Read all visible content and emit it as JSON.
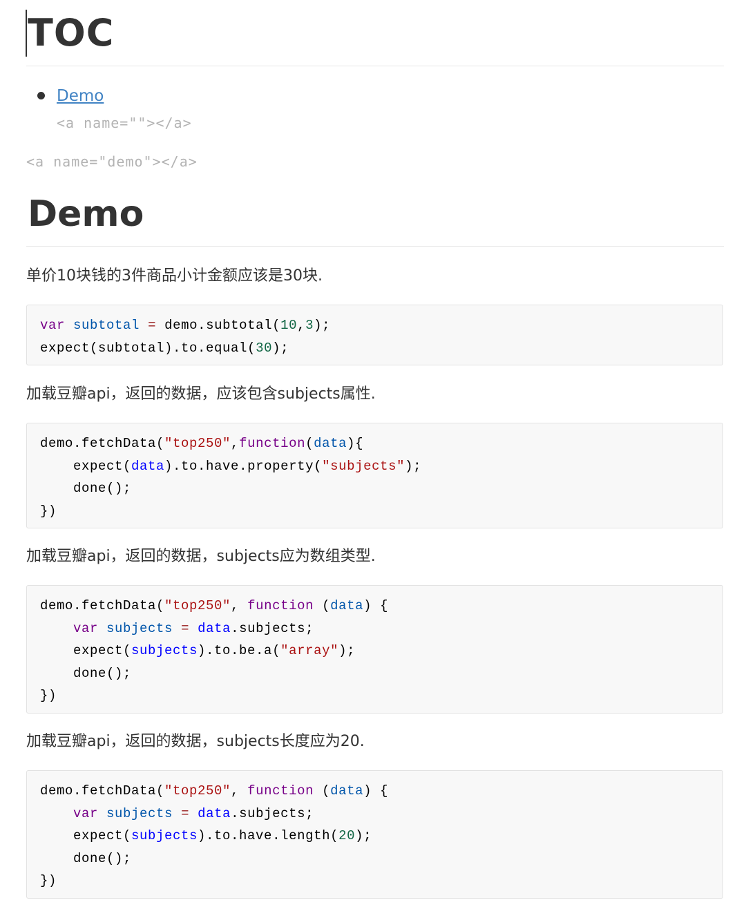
{
  "toc": {
    "title": "TOC",
    "items": [
      {
        "label": "Demo"
      }
    ],
    "anchor_under_item": "<a name=\"\"></a>"
  },
  "anchor_before_demo": "<a name=\"demo\"></a>",
  "demo": {
    "title": "Demo",
    "sections": [
      {
        "text": "单价10块钱的3件商品小计金额应该是30块.",
        "code": [
          [
            [
              "kw",
              "var"
            ],
            [
              "pl",
              " "
            ],
            [
              "def",
              "subtotal"
            ],
            [
              "pl",
              " "
            ],
            [
              "op",
              "="
            ],
            [
              "pl",
              " demo.subtotal("
            ],
            [
              "num",
              "10"
            ],
            [
              "pl",
              ","
            ],
            [
              "num",
              "3"
            ],
            [
              "pl",
              ");"
            ]
          ],
          [
            [
              "pl",
              "expect(subtotal).to.equal("
            ],
            [
              "num",
              "30"
            ],
            [
              "pl",
              ");"
            ]
          ]
        ]
      },
      {
        "text": "加载豆瓣api，返回的数据，应该包含subjects属性.",
        "code": [
          [
            [
              "pl",
              "demo.fetchData("
            ],
            [
              "str",
              "\"top250\""
            ],
            [
              "pl",
              ","
            ],
            [
              "kw",
              "function"
            ],
            [
              "pl",
              "("
            ],
            [
              "def",
              "data"
            ],
            [
              "pl",
              "){"
            ]
          ],
          [
            [
              "pl",
              "    expect("
            ],
            [
              "var",
              "data"
            ],
            [
              "pl",
              ").to.have.property("
            ],
            [
              "str",
              "\"subjects\""
            ],
            [
              "pl",
              ");"
            ]
          ],
          [
            [
              "pl",
              "    done();"
            ]
          ],
          [
            [
              "pl",
              "})"
            ]
          ]
        ]
      },
      {
        "text": "加载豆瓣api，返回的数据，subjects应为数组类型.",
        "code": [
          [
            [
              "pl",
              "demo.fetchData("
            ],
            [
              "str",
              "\"top250\""
            ],
            [
              "pl",
              ", "
            ],
            [
              "kw",
              "function"
            ],
            [
              "pl",
              " ("
            ],
            [
              "def",
              "data"
            ],
            [
              "pl",
              ") {"
            ]
          ],
          [
            [
              "pl",
              "    "
            ],
            [
              "kw",
              "var"
            ],
            [
              "pl",
              " "
            ],
            [
              "def",
              "subjects"
            ],
            [
              "pl",
              " "
            ],
            [
              "op",
              "="
            ],
            [
              "pl",
              " "
            ],
            [
              "var",
              "data"
            ],
            [
              "pl",
              ".subjects;"
            ]
          ],
          [
            [
              "pl",
              "    expect("
            ],
            [
              "var",
              "subjects"
            ],
            [
              "pl",
              ").to.be.a("
            ],
            [
              "str",
              "\"array\""
            ],
            [
              "pl",
              ");"
            ]
          ],
          [
            [
              "pl",
              "    done();"
            ]
          ],
          [
            [
              "pl",
              "})"
            ]
          ]
        ]
      },
      {
        "text": "加载豆瓣api，返回的数据，subjects长度应为20.",
        "code": [
          [
            [
              "pl",
              "demo.fetchData("
            ],
            [
              "str",
              "\"top250\""
            ],
            [
              "pl",
              ", "
            ],
            [
              "kw",
              "function"
            ],
            [
              "pl",
              " ("
            ],
            [
              "def",
              "data"
            ],
            [
              "pl",
              ") {"
            ]
          ],
          [
            [
              "pl",
              "    "
            ],
            [
              "kw",
              "var"
            ],
            [
              "pl",
              " "
            ],
            [
              "def",
              "subjects"
            ],
            [
              "pl",
              " "
            ],
            [
              "op",
              "="
            ],
            [
              "pl",
              " "
            ],
            [
              "var",
              "data"
            ],
            [
              "pl",
              ".subjects;"
            ]
          ],
          [
            [
              "pl",
              "    expect("
            ],
            [
              "var",
              "subjects"
            ],
            [
              "pl",
              ").to.have.length("
            ],
            [
              "num",
              "20"
            ],
            [
              "pl",
              ");"
            ]
          ],
          [
            [
              "pl",
              "    done();"
            ]
          ],
          [
            [
              "pl",
              "})"
            ]
          ]
        ]
      }
    ]
  }
}
